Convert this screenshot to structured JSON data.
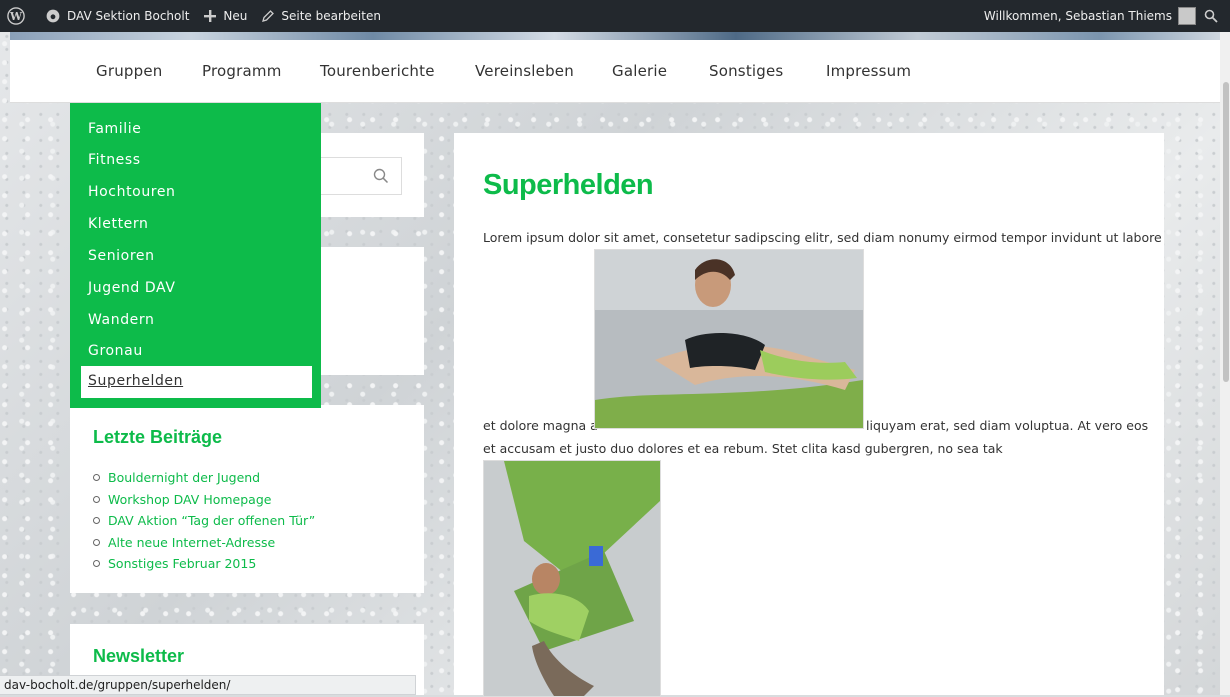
{
  "adminbar": {
    "site_name": "DAV Sektion Bocholt",
    "new_label": "Neu",
    "edit_label": "Seite bearbeiten",
    "welcome": "Willkommen, Sebastian Thiems"
  },
  "nav": {
    "items": [
      "Gruppen",
      "Programm",
      "Tourenberichte",
      "Vereinsleben",
      "Galerie",
      "Sonstiges",
      "Impressum"
    ]
  },
  "dropdown": {
    "items": [
      "Familie",
      "Fitness",
      "Hochtouren",
      "Klettern",
      "Senioren",
      "Jugend DAV",
      "Wandern",
      "Gronau"
    ],
    "active": "Superhelden"
  },
  "sidebar": {
    "recent_title": "Letzte Beiträge",
    "recent_posts": [
      "Bouldernight der Jugend",
      "Workshop DAV Homepage",
      "DAV Aktion “Tag der offenen Tür”",
      "Alte neue Internet-Adresse",
      "Sonstiges Februar 2015"
    ],
    "newsletter_title": "Newsletter"
  },
  "main": {
    "title": "Superhelden",
    "line1": "Lorem ipsum dolor sit amet, consetetur sadipscing elitr, sed diam nonumy eirmod tempor invidunt ut labore",
    "line2_left": "et dolore magna a",
    "line2_right": "liquyam erat, sed diam voluptua. At vero eos",
    "line3": "et accusam et justo duo dolores et ea rebum. Stet clita kasd gubergren, no sea tak"
  },
  "status": {
    "url": "dav-bocholt.de/gruppen/superhelden/"
  },
  "colors": {
    "accent": "#0dbb4a",
    "adminbar": "#23282d"
  }
}
